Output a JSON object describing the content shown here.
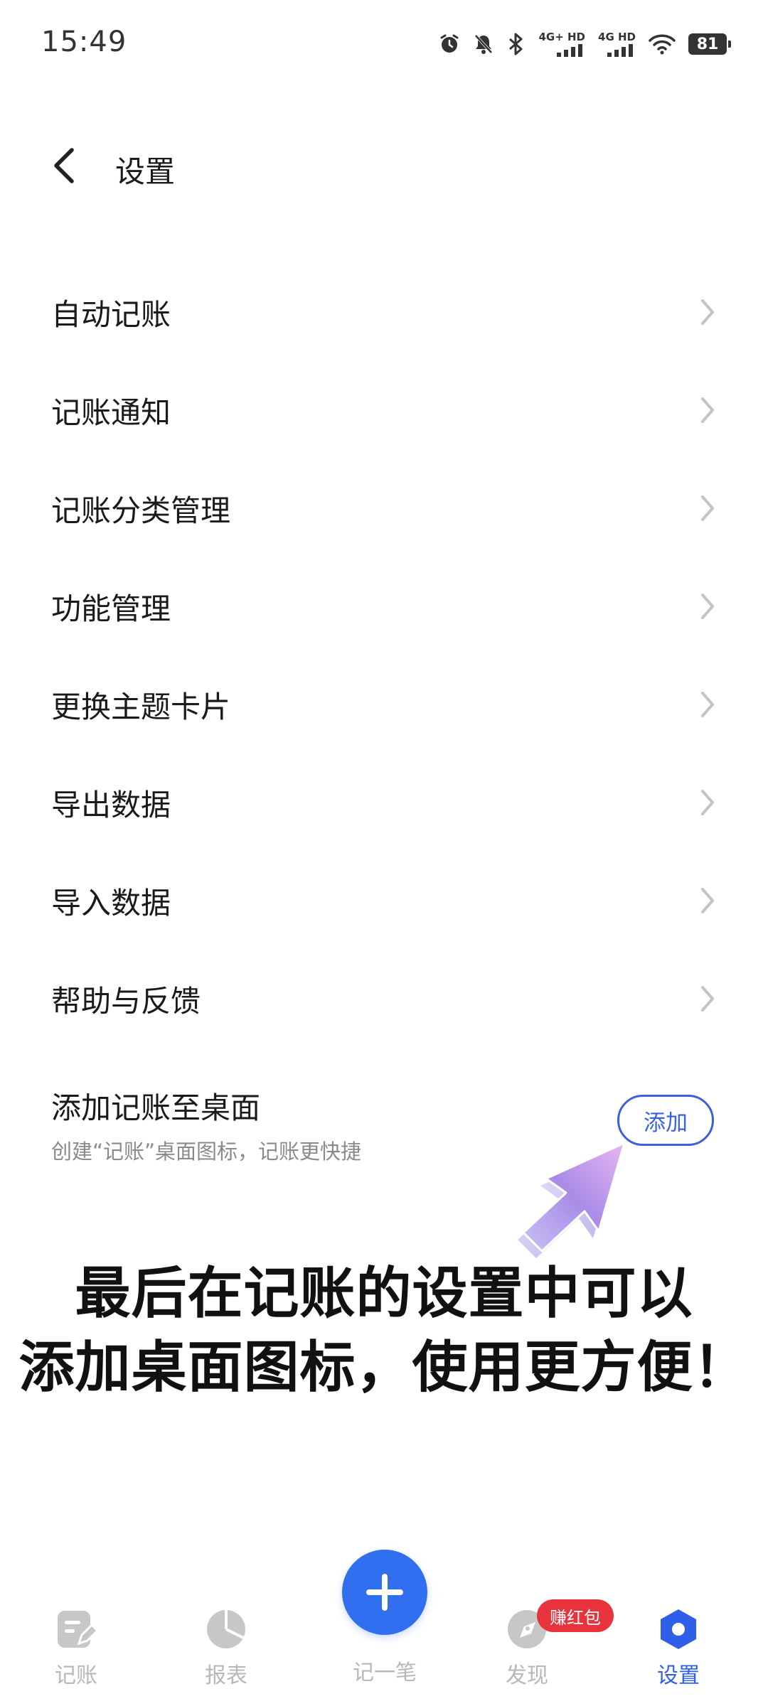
{
  "status_bar": {
    "time": "15:49",
    "network1": "4G+ HD",
    "network2": "4G HD",
    "battery": "81"
  },
  "header": {
    "title": "设置",
    "back_icon": "chevron-left-icon"
  },
  "menu": {
    "items": [
      {
        "label": "自动记账"
      },
      {
        "label": "记账通知"
      },
      {
        "label": "记账分类管理"
      },
      {
        "label": "功能管理"
      },
      {
        "label": "更换主题卡片"
      },
      {
        "label": "导出数据"
      },
      {
        "label": "导入数据"
      },
      {
        "label": "帮助与反馈"
      }
    ]
  },
  "shortcut": {
    "title": "添加记账至桌面",
    "description": "创建“记账”桌面图标，记账更快捷",
    "button_label": "添加"
  },
  "caption": {
    "line1": "最后在记账的设置中可以",
    "line2": "添加桌面图标，使用更方便！"
  },
  "bottom_nav": {
    "items": [
      {
        "label": "记账",
        "icon": "note-edit-icon"
      },
      {
        "label": "报表",
        "icon": "pie-chart-icon"
      },
      {
        "label": "记一笔",
        "icon": "plus-icon"
      },
      {
        "label": "发现",
        "icon": "compass-icon"
      },
      {
        "label": "设置",
        "icon": "settings-hexagon-icon"
      }
    ],
    "active": "设置",
    "promo_badge": "赚红包"
  },
  "colors": {
    "accent": "#2f5fe8",
    "fab": "#2f6ff0",
    "badge": "#e8323c",
    "inactive": "#b8b8b8"
  }
}
